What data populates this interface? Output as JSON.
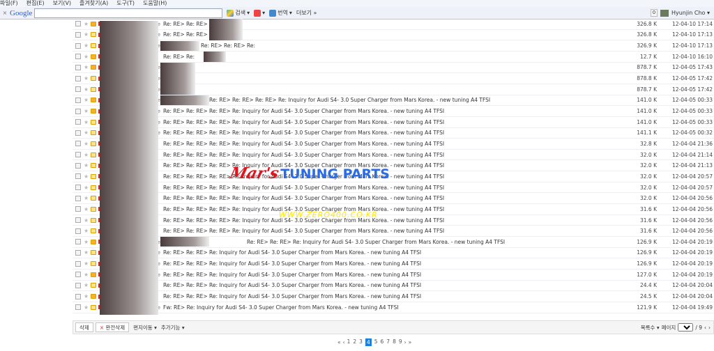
{
  "menu": [
    "파일(F)",
    "편집(E)",
    "보기(V)",
    "즐겨찾기(A)",
    "도구(T)",
    "도움말(H)"
  ],
  "toolbar": {
    "close": "×",
    "google_logo": "Google",
    "search_value": "",
    "search_label": "검색",
    "translate_label": "번역",
    "more_label": "더보기 »"
  },
  "user": {
    "count": "0",
    "name": "Hyunjin Cho"
  },
  "rows": [
    {
      "subject": "Re: RE> Re: RE> Re:",
      "attach": true,
      "new": true,
      "size": "326.8 K",
      "date": "12-04-10 17:14"
    },
    {
      "subject": "Re: RE> Re: RE> Re:",
      "attach": true,
      "new": false,
      "size": "326.8 K",
      "date": "12-04-10 17:13"
    },
    {
      "subject": "Re: RE> Re: RE> Re:",
      "attach": true,
      "new": false,
      "size": "326.9 K",
      "date": "12-04-10 17:13",
      "offset": true
    },
    {
      "subject": "Re: RE> Re:",
      "attach": false,
      "new": true,
      "size": "12.7 K",
      "date": "12-04-10 16:10"
    },
    {
      "subject": "",
      "attach": true,
      "new": true,
      "size": "878.7 K",
      "date": "12-04-05 17:43"
    },
    {
      "subject": "",
      "attach": true,
      "new": false,
      "size": "878.8 K",
      "date": "12-04-05 17:42"
    },
    {
      "subject": "",
      "attach": true,
      "new": false,
      "size": "878.7 K",
      "date": "12-04-05 17:42"
    },
    {
      "subject": "Re: RE> Re: RE> Re: RE> Re: Inquiry for Audi S4- 3.0 Super Charger from Mars Korea. - new tuning A4 TFSI",
      "attach": true,
      "new": true,
      "size": "141.0 K",
      "date": "12-04-05 00:33",
      "offset": true
    },
    {
      "subject": "Re: RE> Re: RE> Re: RE> Re: Inquiry for Audi S4- 3.0 Super Charger from Mars Korea. - new tuning A4 TFSI",
      "attach": true,
      "new": true,
      "size": "141.0 K",
      "date": "12-04-05 00:33"
    },
    {
      "subject": "Re: RE> Re: RE> Re: RE> Re: Inquiry for Audi S4- 3.0 Super Charger from Mars Korea. - new tuning A4 TFSI",
      "attach": true,
      "new": false,
      "size": "141.0 K",
      "date": "12-04-05 00:33"
    },
    {
      "subject": "Re: RE> Re: RE> Re: RE> Re: Inquiry for Audi S4- 3.0 Super Charger from Mars Korea. - new tuning A4 TFSI",
      "attach": true,
      "new": false,
      "size": "141.1 K",
      "date": "12-04-05 00:32"
    },
    {
      "subject": "Re: RE> Re: RE> Re: RE> Re: Inquiry for Audi S4- 3.0 Super Charger from Mars Korea. - new tuning A4 TFSI",
      "attach": false,
      "new": false,
      "size": "32.8 K",
      "date": "12-04-04 21:36"
    },
    {
      "subject": "Re: RE> Re: RE> Re: RE> Re: Inquiry for Audi S4- 3.0 Super Charger from Mars Korea. - new tuning A4 TFSI",
      "attach": false,
      "new": false,
      "size": "32.0 K",
      "date": "12-04-04 21:14"
    },
    {
      "subject": "Re: RE> Re: RE> Re: RE> Re: Inquiry for Audi S4- 3.0 Super Charger from Mars Korea. - new tuning A4 TFSI",
      "attach": false,
      "new": false,
      "size": "32.0 K",
      "date": "12-04-04 21:13"
    },
    {
      "subject": "Re: RE> Re: RE> Re: RE> Re: Inquiry for Audi S4- 3.0 Super Charger from Mars Korea. - new tuning A4 TFSI",
      "attach": false,
      "new": false,
      "size": "32.0 K",
      "date": "12-04-04 20:57"
    },
    {
      "subject": "Re: RE> Re: RE> Re: RE> Re: Inquiry for Audi S4- 3.0 Super Charger from Mars Korea. - new tuning A4 TFSI",
      "attach": false,
      "new": false,
      "size": "32.0 K",
      "date": "12-04-04 20:57"
    },
    {
      "subject": "Re: RE> Re: RE> Re: RE> Re: Inquiry for Audi S4- 3.0 Super Charger from Mars Korea. - new tuning A4 TFSI",
      "attach": false,
      "new": false,
      "size": "32.0 K",
      "date": "12-04-04 20:56"
    },
    {
      "subject": "Re: RE> Re: RE> Re: RE> Re: Inquiry for Audi S4- 3.0 Super Charger from Mars Korea. - new tuning A4 TFSI",
      "attach": false,
      "new": false,
      "size": "31.6 K",
      "date": "12-04-04 20:56"
    },
    {
      "subject": "Re: RE> Re: RE> Re: RE> Re: Inquiry for Audi S4- 3.0 Super Charger from Mars Korea. - new tuning A4 TFSI",
      "attach": false,
      "new": false,
      "size": "31.6 K",
      "date": "12-04-04 20:56"
    },
    {
      "subject": "Re: RE> Re: RE> Re: RE> Re: Inquiry for Audi S4- 3.0 Super Charger from Mars Korea. - new tuning A4 TFSI",
      "attach": false,
      "new": false,
      "size": "31.6 K",
      "date": "12-04-04 20:56"
    },
    {
      "subject": "Re: RE> Re: RE> Re: Inquiry for Audi S4- 3.0 Super Charger from Mars Korea. - new tuning A4 TFSI",
      "attach": true,
      "new": true,
      "size": "126.9 K",
      "date": "12-04-04 20:19",
      "offset": true
    },
    {
      "subject": "Re: RE> Re: RE> Re: Inquiry for Audi S4- 3.0 Super Charger from Mars Korea. - new tuning A4 TFSI",
      "attach": true,
      "new": false,
      "size": "126.9 K",
      "date": "12-04-04 20:19"
    },
    {
      "subject": "Re: RE> Re: RE> Re: Inquiry for Audi S4- 3.0 Super Charger from Mars Korea. - new tuning A4 TFSI",
      "attach": true,
      "new": false,
      "size": "126.9 K",
      "date": "12-04-04 20:19"
    },
    {
      "subject": "Re: RE> Re: RE> Re: Inquiry for Audi S4- 3.0 Super Charger from Mars Korea. - new tuning A4 TFSI",
      "attach": true,
      "new": true,
      "size": "127.0 K",
      "date": "12-04-04 20:19"
    },
    {
      "subject": "Re: RE> Re: RE> Re: Inquiry for Audi S4- 3.0 Super Charger from Mars Korea. - new tuning A4 TFSI",
      "attach": false,
      "new": false,
      "size": "24.4 K",
      "date": "12-04-04 20:04"
    },
    {
      "subject": "Re: RE> Re: RE> Re: Inquiry for Audi S4- 3.0 Super Charger from Mars Korea. - new tuning A4 TFSI",
      "attach": false,
      "new": true,
      "size": "24.5 K",
      "date": "12-04-04 20:04"
    },
    {
      "subject": "Fw: RE> Re: Inquiry for Audi S4- 3.0 Super Charger from Mars Korea. - new tuning A4 TFSI",
      "attach": true,
      "new": false,
      "size": "121.9 K",
      "date": "12-04-04 19:49"
    }
  ],
  "footer": {
    "delete": "삭제",
    "perm_delete": "완전삭제",
    "move": "편지이동 ▾",
    "more": "추가기능 ▾",
    "list_count": "목록수 ▾",
    "page_label": "페이지",
    "page_value": "4",
    "page_total": "/ 9"
  },
  "pager": {
    "first": "«",
    "prev": "‹",
    "pages": [
      "1",
      "2",
      "3",
      "4",
      "5",
      "6",
      "7",
      "8",
      "9"
    ],
    "current": "4",
    "next": "›",
    "last": "»"
  },
  "watermark": {
    "mars": "Mar's",
    "tuning": "TUNING PARTS",
    "url": "WWW.ZERO400.CO.KR"
  }
}
